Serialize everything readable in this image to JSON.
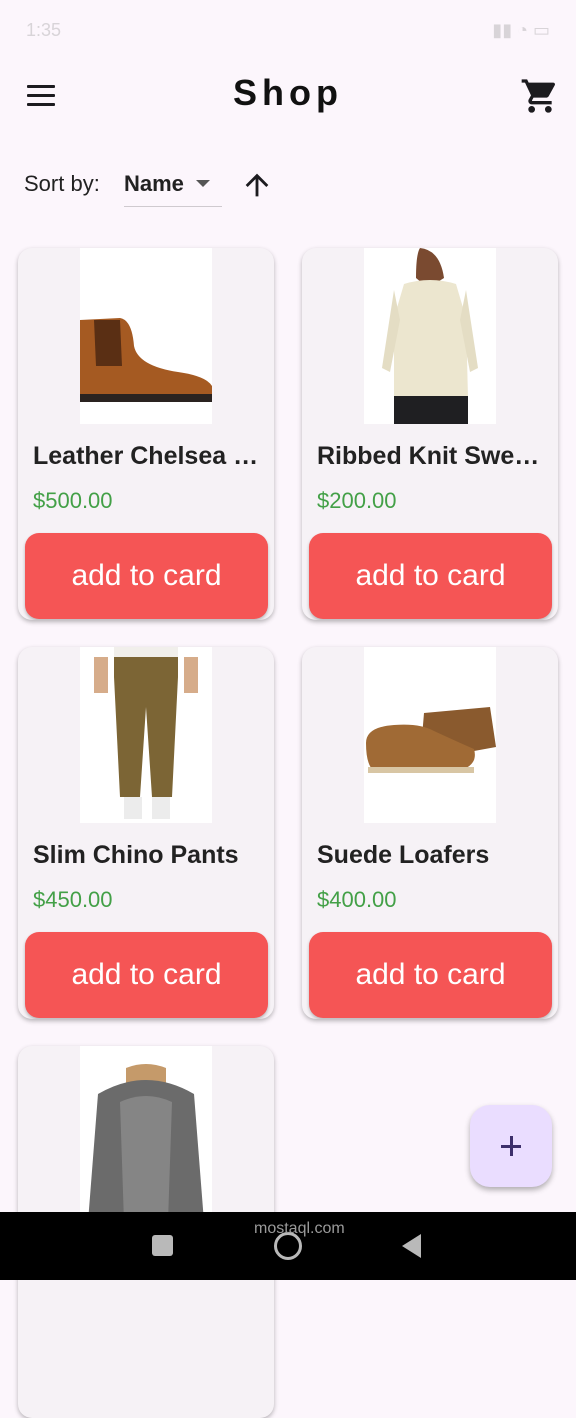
{
  "app": {
    "title": "Shop"
  },
  "sort": {
    "label": "Sort by:",
    "value": "Name"
  },
  "products": [
    {
      "name": "Leather Chelsea …",
      "price": "$500.00",
      "button": "add to card"
    },
    {
      "name": "Ribbed Knit Swe…",
      "price": "$200.00",
      "button": "add to card"
    },
    {
      "name": "Slim Chino Pants",
      "price": "$450.00",
      "button": "add to card"
    },
    {
      "name": "Suede Loafers",
      "price": "$400.00",
      "button": "add to card"
    },
    {
      "name": "",
      "price": "",
      "button": ""
    }
  ],
  "watermark": "mostaql.com",
  "colors": {
    "accent": "#f55555",
    "price": "#43a047",
    "fab": "#eaddff",
    "background": "#fcf6fc"
  },
  "icons": [
    "menu-icon",
    "cart-icon",
    "arrow-up-icon",
    "plus-icon",
    "nav-recents-icon",
    "nav-home-icon",
    "nav-back-icon"
  ]
}
